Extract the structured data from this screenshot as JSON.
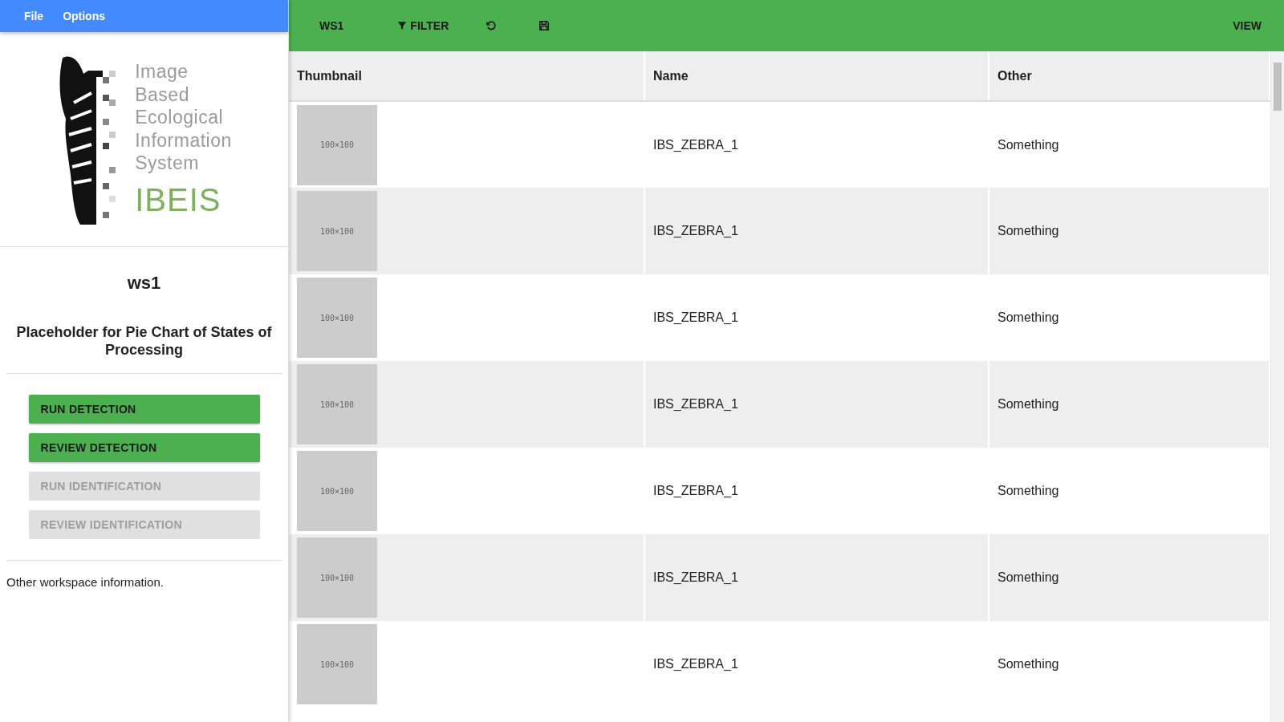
{
  "menu": [
    {
      "label": "File"
    },
    {
      "label": "Options"
    }
  ],
  "logo": {
    "lines": [
      "Image",
      "Based",
      "Ecological",
      "Information",
      "System"
    ],
    "name": "IBEIS"
  },
  "workspace": {
    "title": "ws1",
    "chart_placeholder": "Placeholder for Pie Chart of States of Processing",
    "actions": [
      {
        "label": "RUN DETECTION",
        "disabled": false
      },
      {
        "label": "REVIEW DETECTION",
        "disabled": false
      },
      {
        "label": "RUN IDENTIFICATION",
        "disabled": true
      },
      {
        "label": "REVIEW IDENTIFICATION",
        "disabled": true
      }
    ],
    "info": "Other workspace information."
  },
  "toolbar": {
    "items": [
      {
        "kind": "label",
        "label": "WS1"
      },
      {
        "kind": "filter",
        "label": "FILTER"
      },
      {
        "kind": "undo"
      },
      {
        "kind": "save"
      }
    ],
    "view": "VIEW"
  },
  "table": {
    "columns": [
      "Thumbnail",
      "Name",
      "Other"
    ],
    "rows": [
      {
        "thumbnail": "100×100",
        "name": "IBS_ZEBRA_1",
        "other": "Something"
      },
      {
        "thumbnail": "100×100",
        "name": "IBS_ZEBRA_1",
        "other": "Something"
      },
      {
        "thumbnail": "100×100",
        "name": "IBS_ZEBRA_1",
        "other": "Something"
      },
      {
        "thumbnail": "100×100",
        "name": "IBS_ZEBRA_1",
        "other": "Something"
      },
      {
        "thumbnail": "100×100",
        "name": "IBS_ZEBRA_1",
        "other": "Something"
      },
      {
        "thumbnail": "100×100",
        "name": "IBS_ZEBRA_1",
        "other": "Something"
      },
      {
        "thumbnail": "100×100",
        "name": "IBS_ZEBRA_1",
        "other": "Something"
      }
    ]
  }
}
